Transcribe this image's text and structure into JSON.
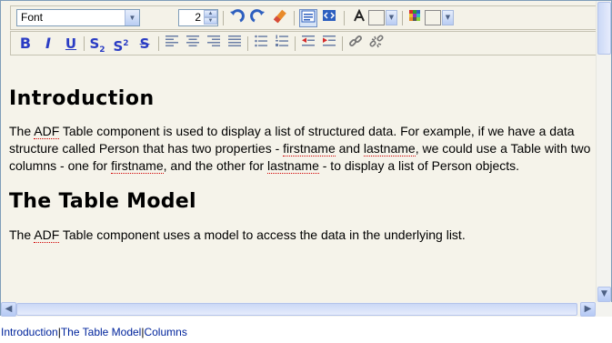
{
  "toolbar": {
    "font_select": {
      "value": "Font"
    },
    "font_size": {
      "value": "2"
    },
    "icons": {
      "undo": "undo-icon",
      "redo": "redo-icon",
      "eraser": "clear-format-icon",
      "rich_text_mode": "rich-text-mode-icon",
      "source_mode": "source-mode-icon",
      "font_color": "font-color-icon",
      "background_color": "background-color-icon"
    },
    "format": {
      "bold": "B",
      "italic": "I",
      "underline": "U",
      "subscript_label": "S",
      "subscript_sub": "2",
      "superscript_label": "S",
      "superscript_sup": "2",
      "strikethrough": "S"
    }
  },
  "document": {
    "heading1": "Introduction",
    "para1": {
      "t1": "The ",
      "adf": "ADF",
      "t2": " Table component is used to display a list of structured data. For example, if we have a data structure called Person that has two properties - ",
      "firstname1": "firstname",
      "t3": " and ",
      "lastname1": "lastname",
      "t4": ", we could use a Table with two columns - one for ",
      "firstname2": "firstname",
      "t5": ", and the other for ",
      "lastname2": "lastname",
      "t6": " - to display a list of Person objects."
    },
    "heading2": "The Table Model",
    "para2": {
      "t1": "The ",
      "adf": "ADF",
      "t2": " Table component uses a model to access the data in the underlying list."
    }
  },
  "breadcrumb": {
    "items": [
      "Introduction",
      "The Table Model",
      "Columns"
    ],
    "separator": "|"
  },
  "colors": {
    "accent": "#2a3cc4",
    "link": "#00249c",
    "spellcheck": "#d00000",
    "editor_bg": "#f5f3ea"
  }
}
